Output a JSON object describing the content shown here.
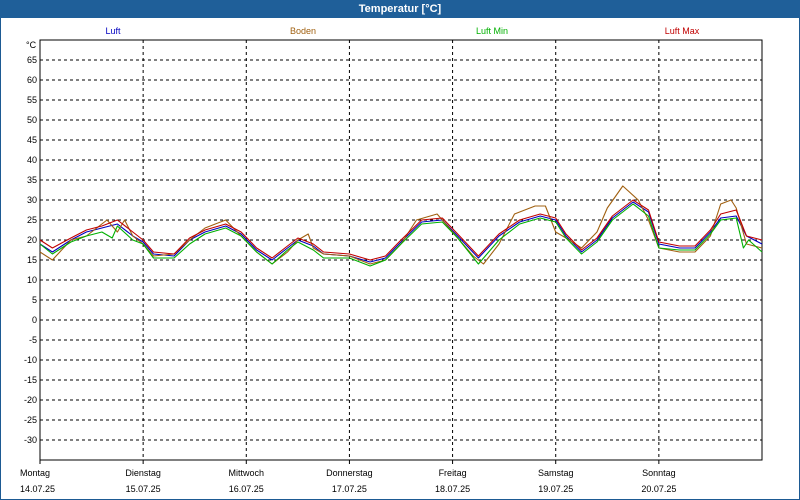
{
  "window": {
    "title": "Temperatur [°C]"
  },
  "colors": {
    "background": "#ffffff",
    "title_bar": "#1f5f99",
    "axis": "#000000",
    "grid": "#000000"
  },
  "chart_data": {
    "type": "line",
    "title": "Temperatur [°C]",
    "ylabel": "°C",
    "ylim": [
      -35,
      70
    ],
    "yticks": [
      65,
      60,
      55,
      50,
      45,
      40,
      35,
      30,
      25,
      20,
      15,
      10,
      5,
      0,
      -5,
      -10,
      -15,
      -20,
      -25,
      -30
    ],
    "xlim": [
      0,
      7
    ],
    "grid": true,
    "legend_position": "top",
    "day_labels": [
      {
        "x": 0,
        "day": "Montag",
        "date": "14.07.25"
      },
      {
        "x": 1,
        "day": "Dienstag",
        "date": "15.07.25"
      },
      {
        "x": 2,
        "day": "Mittwoch",
        "date": "16.07.25"
      },
      {
        "x": 3,
        "day": "Donnerstag",
        "date": "17.07.25"
      },
      {
        "x": 4,
        "day": "Freitag",
        "date": "18.07.25"
      },
      {
        "x": 5,
        "day": "Samstag",
        "date": "19.07.25"
      },
      {
        "x": 6,
        "day": "Sonntag",
        "date": "20.07.25"
      }
    ],
    "series": [
      {
        "name": "Luft",
        "color": "#0000c0",
        "points": [
          [
            0,
            19
          ],
          [
            0.12,
            17
          ],
          [
            0.3,
            20
          ],
          [
            0.45,
            22
          ],
          [
            0.6,
            23
          ],
          [
            0.75,
            24
          ],
          [
            0.9,
            21
          ],
          [
            1.0,
            19.5
          ],
          [
            1.1,
            16.5
          ],
          [
            1.3,
            16
          ],
          [
            1.45,
            20
          ],
          [
            1.6,
            22
          ],
          [
            1.8,
            23.5
          ],
          [
            1.95,
            21.5
          ],
          [
            2.1,
            17.5
          ],
          [
            2.25,
            15
          ],
          [
            2.4,
            18
          ],
          [
            2.5,
            20
          ],
          [
            2.65,
            18.5
          ],
          [
            2.75,
            16.5
          ],
          [
            3.0,
            16
          ],
          [
            3.2,
            14.5
          ],
          [
            3.35,
            15.5
          ],
          [
            3.5,
            19.5
          ],
          [
            3.7,
            24.5
          ],
          [
            3.9,
            25
          ],
          [
            4.05,
            21
          ],
          [
            4.25,
            15.5
          ],
          [
            4.45,
            21
          ],
          [
            4.65,
            24.5
          ],
          [
            4.85,
            26
          ],
          [
            5.0,
            25
          ],
          [
            5.1,
            21
          ],
          [
            5.25,
            17
          ],
          [
            5.4,
            20
          ],
          [
            5.55,
            25.5
          ],
          [
            5.75,
            29.5
          ],
          [
            5.9,
            27
          ],
          [
            6.0,
            19
          ],
          [
            6.2,
            18
          ],
          [
            6.35,
            18
          ],
          [
            6.5,
            22
          ],
          [
            6.6,
            25.5
          ],
          [
            6.75,
            26
          ],
          [
            6.85,
            21
          ],
          [
            7.0,
            19
          ]
        ]
      },
      {
        "name": "Boden",
        "color": "#a06010",
        "points": [
          [
            0,
            17
          ],
          [
            0.12,
            15
          ],
          [
            0.3,
            20
          ],
          [
            0.45,
            21
          ],
          [
            0.55,
            23
          ],
          [
            0.65,
            25
          ],
          [
            0.75,
            22
          ],
          [
            0.82,
            25
          ],
          [
            0.9,
            21
          ],
          [
            1.0,
            19
          ],
          [
            1.1,
            16
          ],
          [
            1.3,
            16.5
          ],
          [
            1.45,
            20
          ],
          [
            1.6,
            23
          ],
          [
            1.8,
            25
          ],
          [
            1.95,
            21
          ],
          [
            2.1,
            17
          ],
          [
            2.25,
            14
          ],
          [
            2.4,
            17
          ],
          [
            2.5,
            20
          ],
          [
            2.6,
            21.5
          ],
          [
            2.65,
            18
          ],
          [
            2.75,
            16.5
          ],
          [
            3.0,
            16
          ],
          [
            3.2,
            14
          ],
          [
            3.35,
            15
          ],
          [
            3.5,
            19
          ],
          [
            3.65,
            25
          ],
          [
            3.85,
            26.5
          ],
          [
            4.0,
            22
          ],
          [
            4.2,
            16
          ],
          [
            4.3,
            14
          ],
          [
            4.45,
            19
          ],
          [
            4.6,
            26.5
          ],
          [
            4.8,
            28.5
          ],
          [
            4.9,
            28.5
          ],
          [
            5.0,
            22
          ],
          [
            5.1,
            20.5
          ],
          [
            5.25,
            18
          ],
          [
            5.4,
            22
          ],
          [
            5.5,
            28
          ],
          [
            5.65,
            33.5
          ],
          [
            5.8,
            30
          ],
          [
            5.9,
            25
          ],
          [
            6.0,
            18
          ],
          [
            6.2,
            17
          ],
          [
            6.35,
            17
          ],
          [
            6.5,
            21
          ],
          [
            6.6,
            29
          ],
          [
            6.7,
            30
          ],
          [
            6.75,
            28
          ],
          [
            6.85,
            19
          ],
          [
            7.0,
            18
          ]
        ]
      },
      {
        "name": "Luft Min",
        "color": "#00b000",
        "points": [
          [
            0,
            19
          ],
          [
            0.12,
            16.5
          ],
          [
            0.3,
            19.5
          ],
          [
            0.45,
            21
          ],
          [
            0.6,
            22
          ],
          [
            0.7,
            20.5
          ],
          [
            0.75,
            23.5
          ],
          [
            0.9,
            20
          ],
          [
            1.0,
            19
          ],
          [
            1.1,
            15.5
          ],
          [
            1.3,
            15.5
          ],
          [
            1.45,
            19
          ],
          [
            1.6,
            21.5
          ],
          [
            1.8,
            23
          ],
          [
            1.95,
            21
          ],
          [
            2.1,
            17
          ],
          [
            2.25,
            14
          ],
          [
            2.4,
            17.5
          ],
          [
            2.5,
            19.5
          ],
          [
            2.65,
            17.5
          ],
          [
            2.75,
            15.5
          ],
          [
            3.0,
            15.5
          ],
          [
            3.2,
            13.5
          ],
          [
            3.35,
            15
          ],
          [
            3.5,
            19
          ],
          [
            3.7,
            24
          ],
          [
            3.9,
            24.5
          ],
          [
            4.05,
            20.5
          ],
          [
            4.25,
            14
          ],
          [
            4.45,
            20
          ],
          [
            4.65,
            24
          ],
          [
            4.85,
            25.5
          ],
          [
            5.0,
            24.5
          ],
          [
            5.1,
            20.5
          ],
          [
            5.25,
            16.5
          ],
          [
            5.4,
            19.5
          ],
          [
            5.55,
            25
          ],
          [
            5.75,
            29
          ],
          [
            5.9,
            26
          ],
          [
            6.0,
            18
          ],
          [
            6.2,
            17.5
          ],
          [
            6.35,
            17.5
          ],
          [
            6.5,
            21.5
          ],
          [
            6.6,
            25
          ],
          [
            6.75,
            25.5
          ],
          [
            6.82,
            18
          ],
          [
            6.87,
            20
          ],
          [
            7.0,
            17
          ]
        ]
      },
      {
        "name": "Luft Max",
        "color": "#c00000",
        "points": [
          [
            0,
            20
          ],
          [
            0.12,
            18
          ],
          [
            0.3,
            20.5
          ],
          [
            0.45,
            22.5
          ],
          [
            0.6,
            23.5
          ],
          [
            0.75,
            25
          ],
          [
            0.9,
            22
          ],
          [
            1.0,
            20
          ],
          [
            1.1,
            17
          ],
          [
            1.3,
            16.5
          ],
          [
            1.45,
            20.5
          ],
          [
            1.6,
            22.5
          ],
          [
            1.8,
            24
          ],
          [
            1.95,
            22
          ],
          [
            2.1,
            18
          ],
          [
            2.25,
            15.5
          ],
          [
            2.4,
            18.5
          ],
          [
            2.5,
            20.5
          ],
          [
            2.65,
            19
          ],
          [
            2.75,
            17
          ],
          [
            3.0,
            16.5
          ],
          [
            3.2,
            15
          ],
          [
            3.35,
            16
          ],
          [
            3.5,
            20
          ],
          [
            3.7,
            25
          ],
          [
            3.9,
            25.5
          ],
          [
            4.05,
            21.5
          ],
          [
            4.25,
            16
          ],
          [
            4.45,
            21.5
          ],
          [
            4.65,
            25
          ],
          [
            4.85,
            26.5
          ],
          [
            5.0,
            25.5
          ],
          [
            5.1,
            21.5
          ],
          [
            5.25,
            17.5
          ],
          [
            5.4,
            20.5
          ],
          [
            5.55,
            26
          ],
          [
            5.75,
            30
          ],
          [
            5.9,
            27.5
          ],
          [
            6.0,
            19.5
          ],
          [
            6.2,
            18.5
          ],
          [
            6.35,
            18.5
          ],
          [
            6.5,
            22.5
          ],
          [
            6.6,
            26.5
          ],
          [
            6.75,
            27.5
          ],
          [
            6.85,
            21
          ],
          [
            7.0,
            20
          ]
        ]
      }
    ]
  }
}
